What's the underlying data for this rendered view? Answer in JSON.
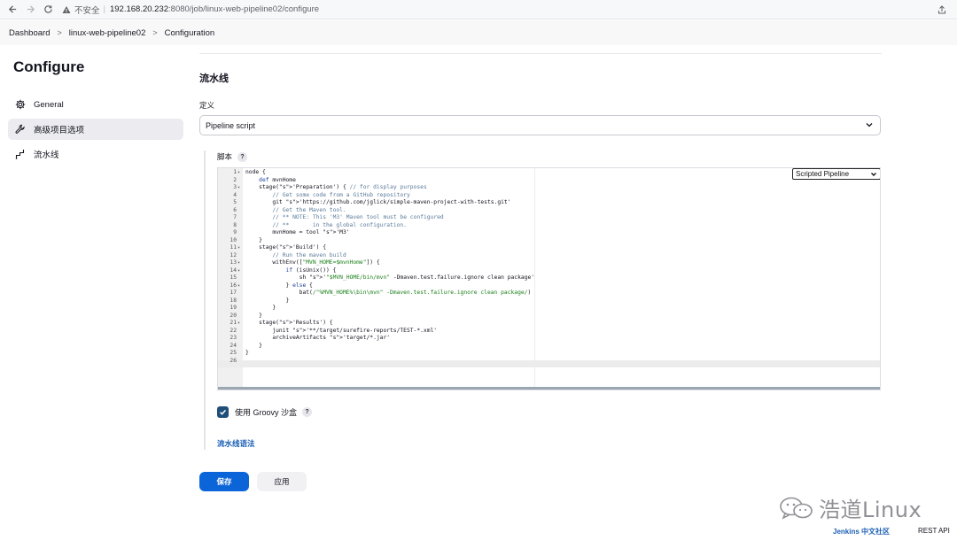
{
  "browser": {
    "insecure_label": "不安全",
    "url_host": "192.168.20.232",
    "url_path": ":8080/job/linux-web-pipeline02/configure"
  },
  "breadcrumb": [
    "Dashboard",
    "linux-web-pipeline02",
    "Configuration"
  ],
  "sidebar": {
    "title": "Configure",
    "items": [
      {
        "label": "General",
        "icon": "gear-icon"
      },
      {
        "label": "高级项目选项",
        "icon": "wrench-icon",
        "active": true
      },
      {
        "label": "流水线",
        "icon": "pipeline-icon"
      }
    ]
  },
  "main": {
    "section_title": "流水线",
    "definition_label": "定义",
    "definition_value": "Pipeline script",
    "script_label": "脚本",
    "help_glyph": "?",
    "mode_select_value": "Scripted Pipeline",
    "code_lines": [
      "node {",
      "    def mvnHome",
      "    stage('Preparation') { // for display purposes",
      "        // Get some code from a GitHub repository",
      "        git 'https://github.com/jglick/simple-maven-project-with-tests.git'",
      "        // Get the Maven tool.",
      "        // ** NOTE: This 'M3' Maven tool must be configured",
      "        // **       in the global configuration.",
      "        mvnHome = tool 'M3'",
      "    }",
      "    stage('Build') {",
      "        // Run the maven build",
      "        withEnv([\"MVN_HOME=$mvnHome\"]) {",
      "            if (isUnix()) {",
      "                sh '\"$MVN_HOME/bin/mvn\" -Dmaven.test.failure.ignore clean package'",
      "            } else {",
      "                bat(/\"%MVN_HOME%\\bin\\mvn\" -Dmaven.test.failure.ignore clean package/)",
      "            }",
      "        }",
      "    }",
      "    stage('Results') {",
      "        junit '**/target/surefire-reports/TEST-*.xml'",
      "        archiveArtifacts 'target/*.jar'",
      "    }",
      "}",
      ""
    ],
    "foldable_lines": [
      1,
      3,
      11,
      13,
      14,
      16,
      21
    ],
    "sandbox_label": "使用 Groovy 沙盒",
    "sandbox_checked": true,
    "syntax_link": "流水线语法",
    "save_label": "保存",
    "apply_label": "应用"
  },
  "watermark": {
    "text": "浩道Linux"
  },
  "footer": {
    "jenkins_link": "Jenkins 中文社区",
    "rest_api": "REST API"
  },
  "colors": {
    "primary_button": "#0b64d8",
    "link": "#1a5fb4",
    "checkbox": "#1f4e79"
  }
}
